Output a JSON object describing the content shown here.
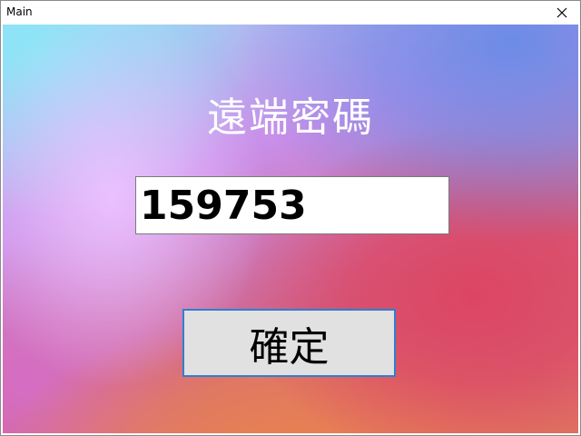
{
  "window": {
    "title": "Main",
    "close_icon": "close-icon"
  },
  "main": {
    "heading": "遠端密碼",
    "password_value": "159753",
    "confirm_label": "確定"
  },
  "colors": {
    "heading_text": "#ffffff",
    "button_border": "#2f7fd0",
    "button_bg": "#e1e1e1",
    "field_bg": "#ffffff"
  }
}
